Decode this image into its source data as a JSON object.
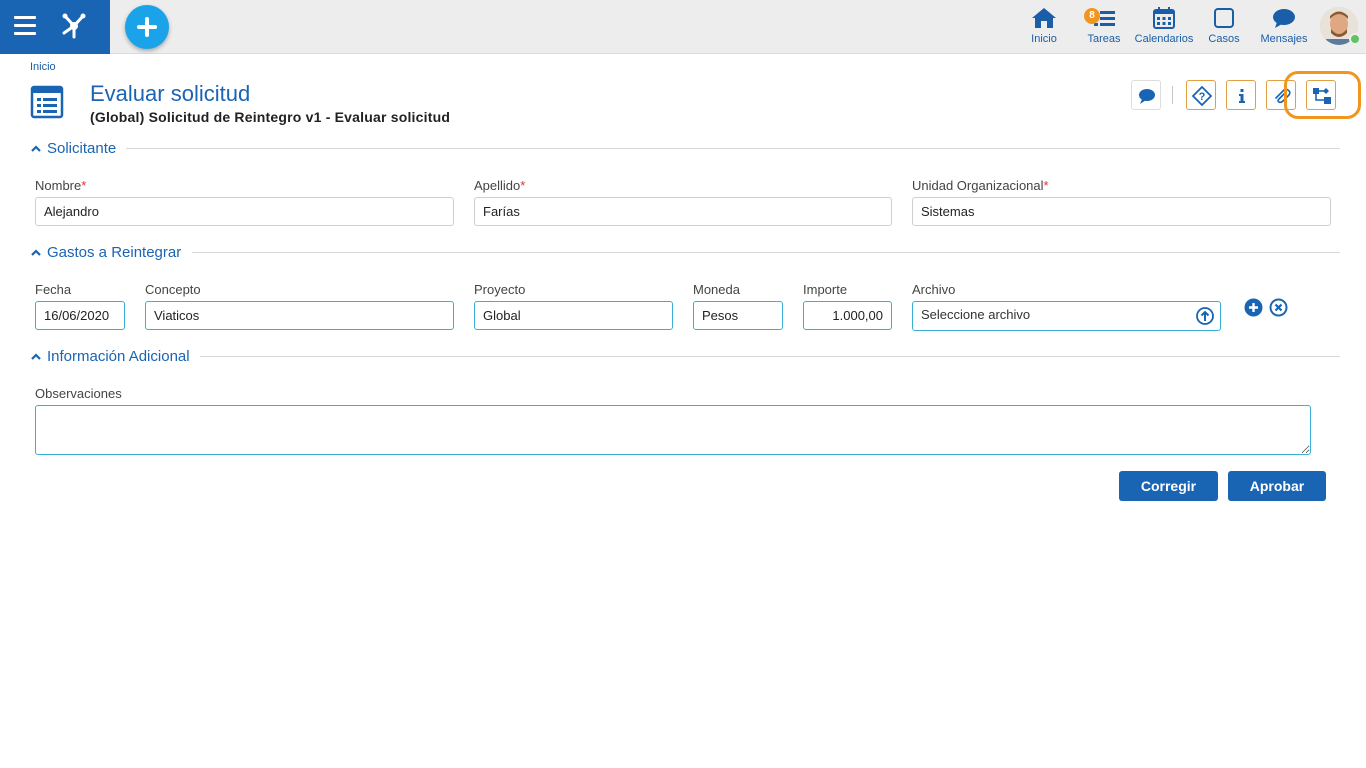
{
  "topbar": {
    "nav": [
      {
        "label": "Inicio",
        "icon": "home-icon"
      },
      {
        "label": "Tareas",
        "icon": "tasks-icon",
        "badge": "8"
      },
      {
        "label": "Calendarios",
        "icon": "calendar-icon"
      },
      {
        "label": "Casos",
        "icon": "cases-icon"
      },
      {
        "label": "Mensajes",
        "icon": "messages-icon"
      }
    ]
  },
  "breadcrumb": "Inicio",
  "page": {
    "title": "Evaluar solicitud",
    "subtitle": "(Global) Solicitud de Reintegro v1 - Evaluar solicitud"
  },
  "sections": {
    "solicitante": {
      "title": "Solicitante",
      "nombre_label": "Nombre",
      "nombre_value": "Alejandro",
      "apellido_label": "Apellido",
      "apellido_value": "Farías",
      "unidad_label": "Unidad Organizacional",
      "unidad_value": "Sistemas"
    },
    "gastos": {
      "title": "Gastos a Reintegrar",
      "fecha_label": "Fecha",
      "fecha_value": "16/06/2020",
      "concepto_label": "Concepto",
      "concepto_value": "Viaticos",
      "proyecto_label": "Proyecto",
      "proyecto_value": "Global",
      "moneda_label": "Moneda",
      "moneda_value": "Pesos",
      "importe_label": "Importe",
      "importe_value": "1.000,00",
      "archivo_label": "Archivo",
      "archivo_placeholder": "Seleccione archivo"
    },
    "adicional": {
      "title": "Información Adicional",
      "observaciones_label": "Observaciones",
      "observaciones_value": ""
    }
  },
  "actions": {
    "corregir": "Corregir",
    "aprobar": "Aprobar"
  },
  "colors": {
    "brand": "#1a64b4",
    "accent": "#1aa3e8",
    "highlight": "#f0961e"
  }
}
